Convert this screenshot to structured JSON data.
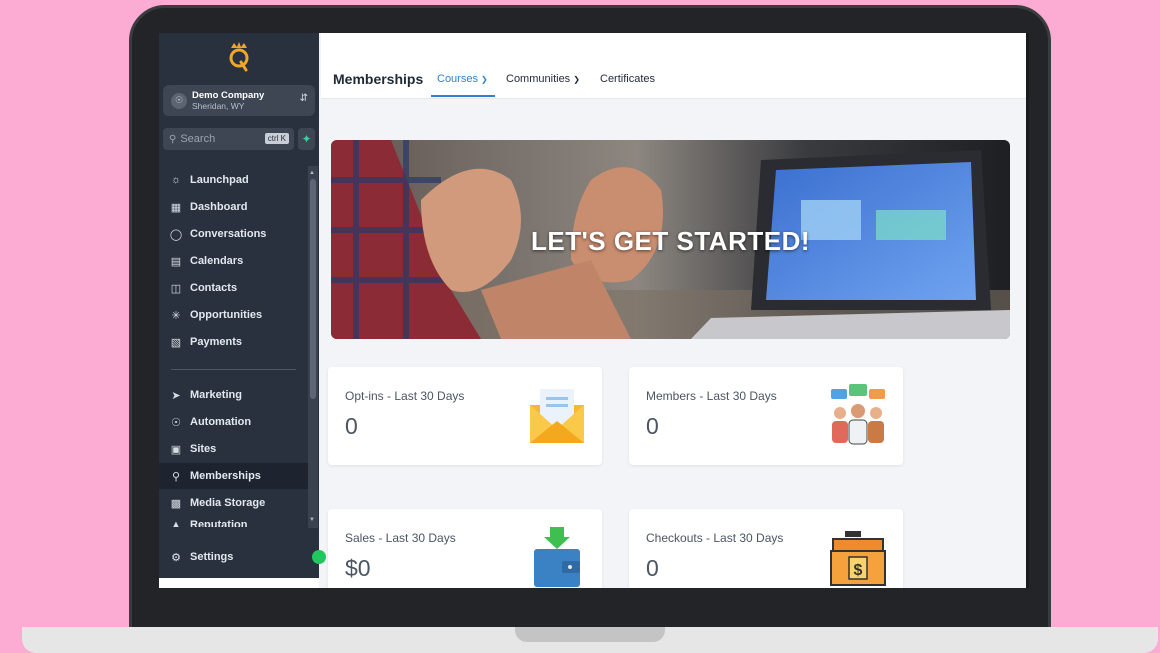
{
  "app": {
    "company_name": "Demo Company",
    "company_location": "Sheridan, WY"
  },
  "search": {
    "placeholder": "Search",
    "shortcut": "ctrl K"
  },
  "sidebar": {
    "items": [
      {
        "label": "Launchpad",
        "icon": "rocket-icon"
      },
      {
        "label": "Dashboard",
        "icon": "grid-icon"
      },
      {
        "label": "Conversations",
        "icon": "chat-icon"
      },
      {
        "label": "Calendars",
        "icon": "calendar-icon"
      },
      {
        "label": "Contacts",
        "icon": "contact-card-icon"
      },
      {
        "label": "Opportunities",
        "icon": "pipeline-icon"
      },
      {
        "label": "Payments",
        "icon": "receipt-icon"
      },
      {
        "label": "Marketing",
        "icon": "send-icon"
      },
      {
        "label": "Automation",
        "icon": "automation-icon"
      },
      {
        "label": "Sites",
        "icon": "globe-icon"
      },
      {
        "label": "Memberships",
        "icon": "award-icon",
        "active": true
      },
      {
        "label": "Media Storage",
        "icon": "image-icon"
      },
      {
        "label": "Reputation",
        "icon": "star-icon"
      }
    ],
    "settings_label": "Settings"
  },
  "header": {
    "title": "Memberships",
    "tabs": [
      {
        "label": "Courses",
        "active": true
      },
      {
        "label": "Communities"
      },
      {
        "label": "Certificates"
      }
    ]
  },
  "banner": {
    "text": "LET'S GET STARTED!"
  },
  "cards": [
    {
      "label": "Opt-ins - Last 30 Days",
      "value": "0",
      "icon": "envelope-icon"
    },
    {
      "label": "Members - Last 30 Days",
      "value": "0",
      "icon": "members-icon"
    },
    {
      "label": "Sales - Last 30 Days",
      "value": "$0",
      "icon": "wallet-icon"
    },
    {
      "label": "Checkouts - Last 30 Days",
      "value": "0",
      "icon": "cash-register-icon"
    }
  ],
  "colors": {
    "accent": "#2f7fd3",
    "sidebar": "#29313e",
    "background": "#fcabd3"
  }
}
